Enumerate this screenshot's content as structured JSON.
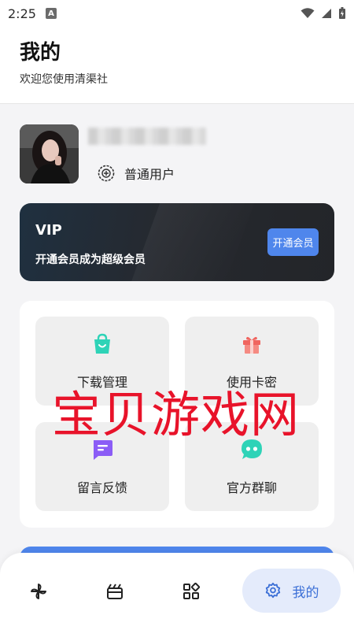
{
  "status_bar": {
    "time": "2:25",
    "app_badge": "A"
  },
  "header": {
    "title": "我的",
    "subtitle": "欢迎您使用清渠社"
  },
  "profile": {
    "level_label": "普通用户"
  },
  "vip": {
    "title": "VIP",
    "description": "开通会员成为超级会员",
    "button_label": "开通会员"
  },
  "features": [
    {
      "label": "下载管理",
      "icon": "shopping-bag-icon",
      "color": "#2ed3b7"
    },
    {
      "label": "使用卡密",
      "icon": "gift-icon",
      "color": "#f0655f"
    },
    {
      "label": "留言反馈",
      "icon": "message-icon",
      "color": "#8b5cf6"
    },
    {
      "label": "官方群聊",
      "icon": "chat-bubble-icon",
      "color": "#2ed3b7"
    }
  ],
  "watermark": "宝贝游戏网",
  "bottom_nav": {
    "items": [
      {
        "icon": "pinwheel-icon"
      },
      {
        "icon": "film-box-icon"
      },
      {
        "icon": "apps-icon"
      }
    ],
    "active": {
      "icon": "gear-icon",
      "label": "我的"
    }
  },
  "colors": {
    "accent": "#4f86ec",
    "active_tab_bg": "#e4ebfb"
  }
}
